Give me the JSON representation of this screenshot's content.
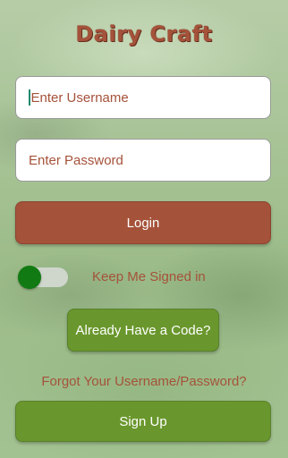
{
  "app": {
    "title": "Dairy Craft"
  },
  "login_form": {
    "username_placeholder": "Enter Username",
    "password_placeholder": "Enter Password",
    "login_label": "Login",
    "keep_signed_in_label": "Keep Me Signed in",
    "keep_signed_in_state": "off",
    "code_button_label": "Already Have a Code?",
    "forgot_link_label": "Forgot Your Username/Password?",
    "signup_label": "Sign Up"
  },
  "colors": {
    "accent_brown": "#a5523a",
    "accent_green": "#6a972d",
    "toggle_knob": "#117a12"
  },
  "icons": {
    "toggle": "switch-toggle"
  }
}
